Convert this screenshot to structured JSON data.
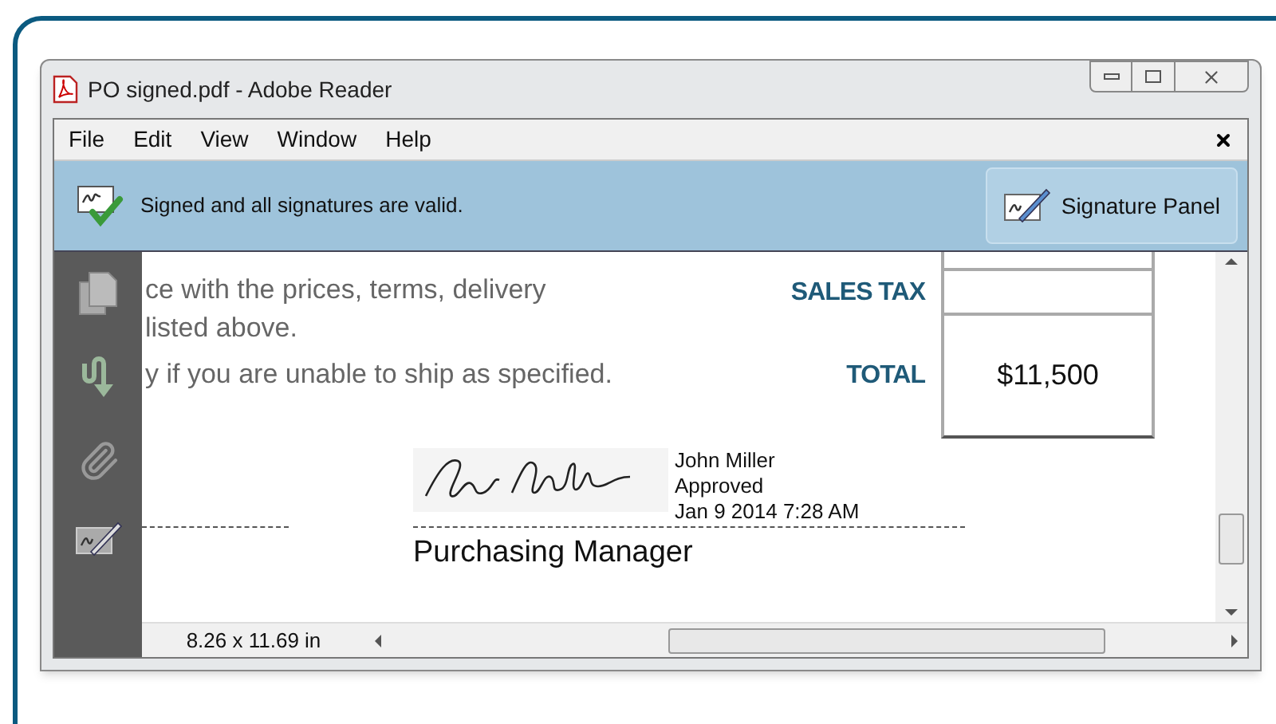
{
  "window": {
    "title": "PO signed.pdf - Adobe Reader"
  },
  "menu": [
    "File",
    "Edit",
    "View",
    "Window",
    "Help"
  ],
  "banner": {
    "message": "Signed and all signatures are valid.",
    "button": "Signature Panel"
  },
  "document": {
    "lines": [
      "ce with the prices, terms, delivery",
      "listed above.",
      "y if you are unable to ship as specified."
    ],
    "totals": [
      {
        "label": "SALES TAX"
      },
      {
        "label": "TOTAL",
        "value": "$11,500"
      }
    ],
    "signature": {
      "name": "John Miller",
      "reason": "Approved",
      "date": "Jan 9 2014 7:28 AM",
      "title": "Purchasing Manager"
    }
  },
  "status_bar": {
    "page_size": "8.26 x 11.69 in"
  }
}
